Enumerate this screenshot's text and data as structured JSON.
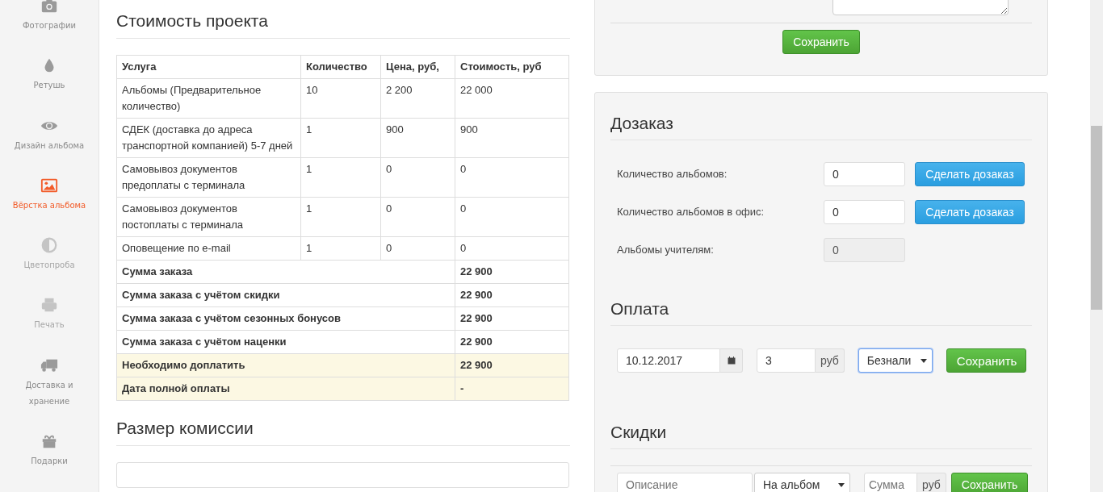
{
  "sidebar": {
    "items": [
      {
        "label": "Фотографии",
        "selected": false,
        "disabled": false
      },
      {
        "label": "Ретушь",
        "selected": false,
        "disabled": false
      },
      {
        "label": "Дизайн альбома",
        "selected": false,
        "disabled": false
      },
      {
        "label": "Вёрстка альбома",
        "selected": true,
        "disabled": false
      },
      {
        "label": "Цветопроба",
        "selected": false,
        "disabled": true
      },
      {
        "label": "Печать",
        "selected": false,
        "disabled": true
      },
      {
        "label": "Доставка и хранение",
        "selected": false,
        "disabled": false
      },
      {
        "label": "Подарки",
        "selected": false,
        "disabled": false
      }
    ]
  },
  "cost": {
    "title": "Стоимость проекта",
    "columns": [
      "Услуга",
      "Количество",
      "Цена, руб,",
      "Стоимость, руб"
    ],
    "rows": [
      [
        "Альбомы (Предварительное количество)",
        "10",
        "2 200",
        "22 000"
      ],
      [
        "СДЕК (доставка до адреса транспортной компанией) 5-7 дней",
        "1",
        "900",
        "900"
      ],
      [
        "Самовывоз документов предоплаты с терминала",
        "1",
        "0",
        "0"
      ],
      [
        "Самовывоз документов постоплаты с терминала",
        "1",
        "0",
        "0"
      ],
      [
        "Оповещение по e-mail",
        "1",
        "0",
        "0"
      ]
    ],
    "totals": [
      {
        "label": "Сумма заказа",
        "value": "22 900",
        "highlight": false
      },
      {
        "label": "Сумма заказа с учётом скидки",
        "value": "22 900",
        "highlight": false
      },
      {
        "label": "Сумма заказа с учётом сезонных бонусов",
        "value": "22 900",
        "highlight": false
      },
      {
        "label": "Сумма заказа с учётом наценки",
        "value": "22 900",
        "highlight": false
      },
      {
        "label": "Необходимо доплатить",
        "value": "22 900",
        "highlight": true
      },
      {
        "label": "Дата полной оплаты",
        "value": "-",
        "highlight": true
      }
    ]
  },
  "commission": {
    "title": "Размер комиссии"
  },
  "comment_panel": {
    "save_button": "Сохранить"
  },
  "reorder": {
    "title": "Дозаказ",
    "rows": [
      {
        "label": "Количество альбомов:",
        "value": "0",
        "disabled": false,
        "button": "Сделать дозаказ"
      },
      {
        "label": "Количество альбомов в офис:",
        "value": "0",
        "disabled": false,
        "button": "Сделать дозаказ"
      },
      {
        "label": "Альбомы учителям:",
        "value": "0",
        "disabled": true
      }
    ]
  },
  "payment": {
    "title": "Оплата",
    "date": "10.12.2017",
    "amount": "3",
    "unit": "руб",
    "method": "Безнали",
    "method_focused": true,
    "save_button": "Сохранить"
  },
  "discounts": {
    "title": "Скидки",
    "description_placeholder": "Описание",
    "type": "На альбом",
    "sum_placeholder": "Сумма",
    "unit": "руб",
    "save_button": "Сохранить"
  }
}
